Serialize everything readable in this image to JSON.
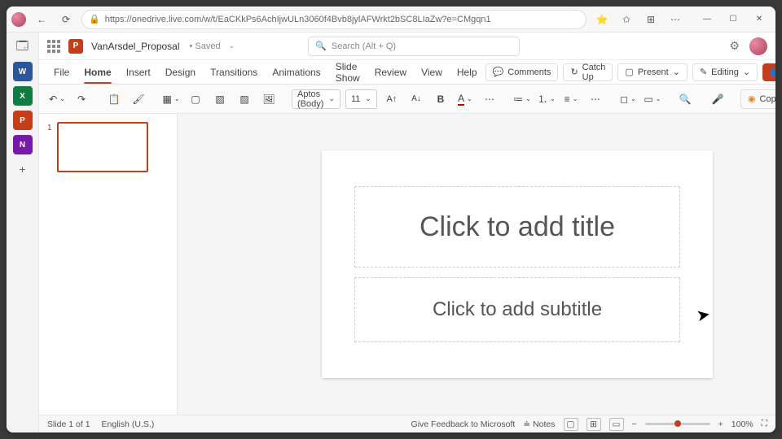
{
  "browser": {
    "url": "https://onedrive.live.com/w/t/EaCKkPs6AchIjwULn3060f4Bvb8jylAFWrkt2bSC8LIaZw?e=CMgqn1"
  },
  "rail": {
    "word": "W",
    "excel": "X",
    "ppt": "P",
    "onenote": "N",
    "plus": "+"
  },
  "header": {
    "app_badge": "P",
    "doc_name": "VanArsdel_Proposal",
    "save_state": "• Saved",
    "chev": "⌄",
    "search_placeholder": "Search (Alt + Q)"
  },
  "tabs": {
    "items": [
      "File",
      "Home",
      "Insert",
      "Design",
      "Transitions",
      "Animations",
      "Slide Show",
      "Review",
      "View",
      "Help"
    ],
    "active_index": 1,
    "comments": "Comments",
    "catchup": "Catch Up",
    "present": "Present",
    "editing": "Editing",
    "share": "Share"
  },
  "ribbon": {
    "font_name": "Aptos (Body)",
    "font_size": "11",
    "copilot": "Copilot"
  },
  "thumb": {
    "num": "1"
  },
  "slide": {
    "title_placeholder": "Click to add title",
    "subtitle_placeholder": "Click to add subtitle"
  },
  "status": {
    "slide_info": "Slide 1 of 1",
    "language": "English (U.S.)",
    "feedback": "Give Feedback to Microsoft",
    "notes": "Notes",
    "zoom": "100%"
  }
}
